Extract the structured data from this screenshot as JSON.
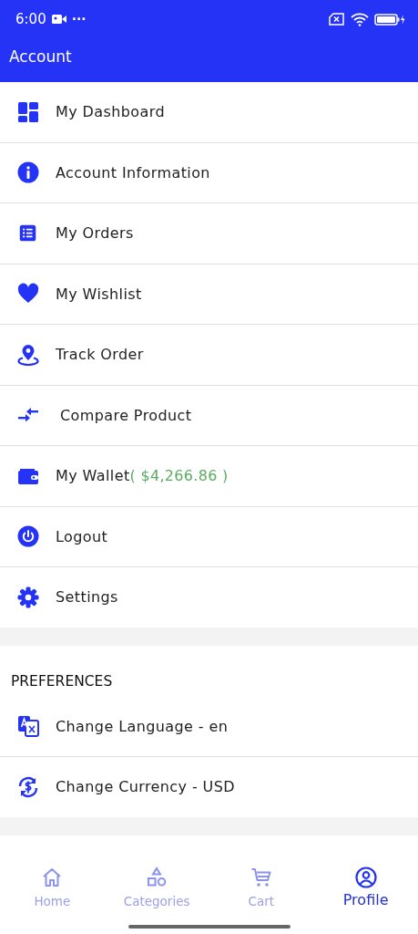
{
  "status_bar": {
    "time": "6:00",
    "more": "···"
  },
  "app_bar": {
    "title": "Account"
  },
  "menu": [
    {
      "kind": "dashboard",
      "label": "My Dashboard"
    },
    {
      "kind": "info",
      "label": "Account Information"
    },
    {
      "kind": "orders",
      "label": "My Orders"
    },
    {
      "kind": "heart",
      "label": "My Wishlist"
    },
    {
      "kind": "pin",
      "label": "Track Order"
    },
    {
      "kind": "compare",
      "label": "Compare Product"
    },
    {
      "kind": "wallet",
      "label": "My Wallet",
      "amount": "( $4,266.86 )"
    },
    {
      "kind": "power",
      "label": "Logout"
    },
    {
      "kind": "gear",
      "label": "Settings"
    }
  ],
  "preferences": {
    "heading": "PREFERENCES",
    "items": [
      {
        "kind": "language",
        "label": "Change Language - en"
      },
      {
        "kind": "currency",
        "label": "Change Currency - USD"
      }
    ]
  },
  "bottom_nav": [
    {
      "kind": "home",
      "label": "Home",
      "selected": false
    },
    {
      "kind": "categories",
      "label": "Categories",
      "selected": false
    },
    {
      "kind": "cart",
      "label": "Cart",
      "selected": false
    },
    {
      "kind": "profile",
      "label": "Profile",
      "selected": true
    }
  ]
}
